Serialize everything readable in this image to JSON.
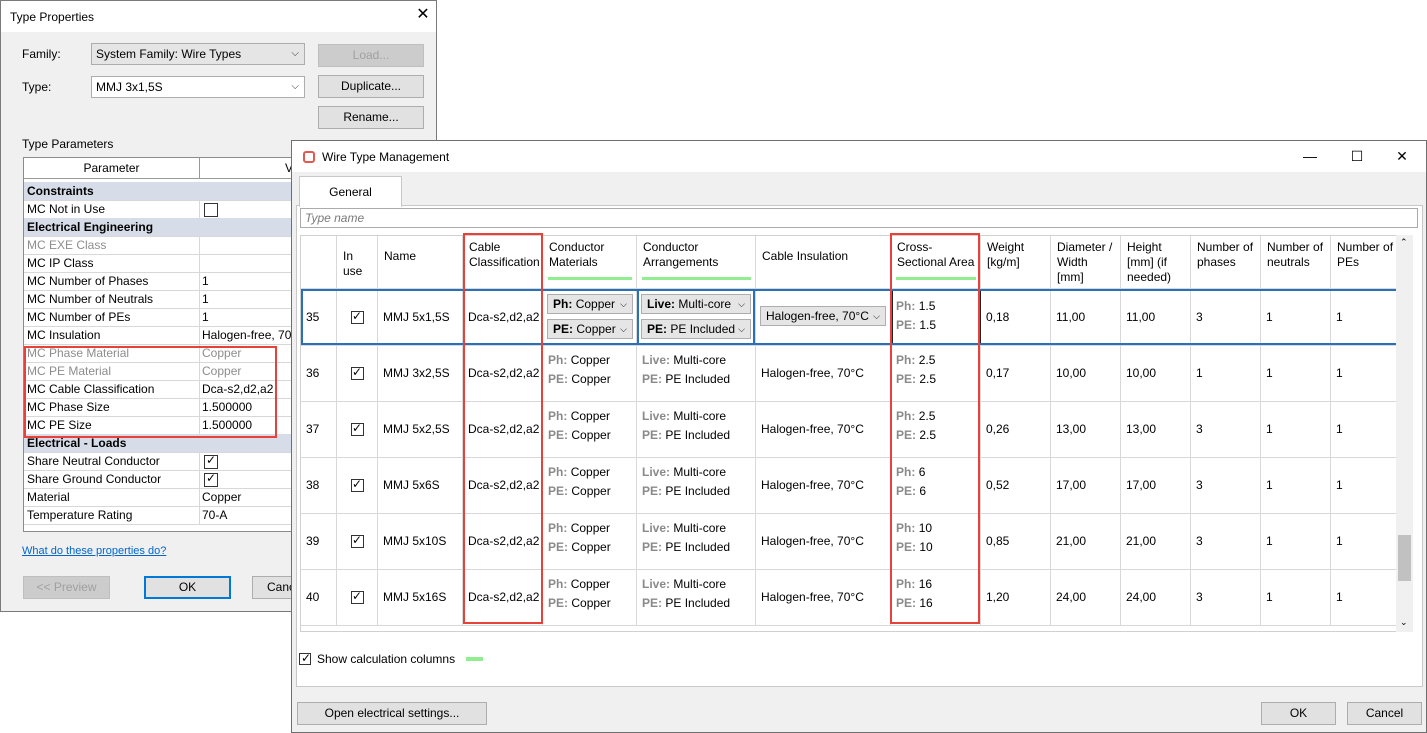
{
  "type_properties": {
    "title": "Type Properties",
    "family_label": "Family:",
    "family_value": "System Family: Wire Types",
    "type_label": "Type:",
    "type_value": "MMJ 3x1,5S",
    "load_button": "Load...",
    "duplicate_button": "Duplicate...",
    "rename_button": "Rename...",
    "type_parameters_label": "Type Parameters",
    "col_parameter": "Parameter",
    "col_value": "Va",
    "rows": [
      {
        "name": "Constraints",
        "group": true
      },
      {
        "name": "MC Not in Use",
        "check": false
      },
      {
        "name": "Electrical Engineering",
        "group": true
      },
      {
        "name": "MC EXE Class",
        "value": "",
        "gray": true
      },
      {
        "name": "MC IP Class",
        "value": ""
      },
      {
        "name": "MC Number of Phases",
        "value": "1"
      },
      {
        "name": "MC Number of Neutrals",
        "value": "1"
      },
      {
        "name": "MC Number of PEs",
        "value": "1"
      },
      {
        "name": "MC Insulation",
        "value": "Halogen-free, 70"
      },
      {
        "name": "MC Phase Material",
        "value": "Copper",
        "gray": true
      },
      {
        "name": "MC PE Material",
        "value": "Copper",
        "gray": true
      },
      {
        "name": "MC Cable Classification",
        "value": "Dca-s2,d2,a2"
      },
      {
        "name": "MC Phase Size",
        "value": "1.500000"
      },
      {
        "name": "MC PE Size",
        "value": "1.500000"
      },
      {
        "name": "Electrical - Loads",
        "group": true
      },
      {
        "name": "Share Neutral Conductor",
        "check": true
      },
      {
        "name": "Share Ground Conductor",
        "check": true
      },
      {
        "name": "Material",
        "value": "Copper"
      },
      {
        "name": "Temperature Rating",
        "value": "70-A"
      }
    ],
    "help_link": "What do these properties do?",
    "preview_button": "<< Preview",
    "ok_button": "OK",
    "cancel_button": "Canc"
  },
  "wire_type_management": {
    "title": "Wire Type Management",
    "tab_general": "General",
    "search_placeholder": "Type name",
    "columns": [
      "",
      "In use",
      "Name",
      "Cable\nClassification",
      "Conductor\nMaterials",
      "Conductor\nArrangements",
      "Cable Insulation",
      "Cross-\nSectional Area",
      "Weight\n[kg/m]",
      "Diameter /\nWidth\n[mm]",
      "Height\n[mm] (if\nneeded)",
      "Number of\nphases",
      "Number of\nneutrals",
      "Number of\nPEs"
    ],
    "rows": [
      {
        "id": "35",
        "name": "MMJ 5x1,5S",
        "classification": "Dca-s2,d2,a2",
        "ph_material": "Copper",
        "pe_material": "Copper",
        "live": "Multi-core",
        "pe_arr": "PE Included",
        "insulation": "Halogen-free, 70°C",
        "ph_area": "1.5",
        "pe_area": "1.5",
        "weight": "0,18",
        "diameter": "11,00",
        "height": "11,00",
        "phases": "3",
        "neutrals": "1",
        "pes": "1"
      },
      {
        "id": "36",
        "name": "MMJ 3x2,5S",
        "classification": "Dca-s2,d2,a2",
        "ph_material": "Copper",
        "pe_material": "Copper",
        "live": "Multi-core",
        "pe_arr": "PE Included",
        "insulation": "Halogen-free, 70°C",
        "ph_area": "2.5",
        "pe_area": "2.5",
        "weight": "0,17",
        "diameter": "10,00",
        "height": "10,00",
        "phases": "1",
        "neutrals": "1",
        "pes": "1"
      },
      {
        "id": "37",
        "name": "MMJ 5x2,5S",
        "classification": "Dca-s2,d2,a2",
        "ph_material": "Copper",
        "pe_material": "Copper",
        "live": "Multi-core",
        "pe_arr": "PE Included",
        "insulation": "Halogen-free, 70°C",
        "ph_area": "2.5",
        "pe_area": "2.5",
        "weight": "0,26",
        "diameter": "13,00",
        "height": "13,00",
        "phases": "3",
        "neutrals": "1",
        "pes": "1"
      },
      {
        "id": "38",
        "name": "MMJ 5x6S",
        "classification": "Dca-s2,d2,a2",
        "ph_material": "Copper",
        "pe_material": "Copper",
        "live": "Multi-core",
        "pe_arr": "PE Included",
        "insulation": "Halogen-free, 70°C",
        "ph_area": "6",
        "pe_area": "6",
        "weight": "0,52",
        "diameter": "17,00",
        "height": "17,00",
        "phases": "3",
        "neutrals": "1",
        "pes": "1"
      },
      {
        "id": "39",
        "name": "MMJ 5x10S",
        "classification": "Dca-s2,d2,a2",
        "ph_material": "Copper",
        "pe_material": "Copper",
        "live": "Multi-core",
        "pe_arr": "PE Included",
        "insulation": "Halogen-free, 70°C",
        "ph_area": "10",
        "pe_area": "10",
        "weight": "0,85",
        "diameter": "21,00",
        "height": "21,00",
        "phases": "3",
        "neutrals": "1",
        "pes": "1"
      },
      {
        "id": "40",
        "name": "MMJ 5x16S",
        "classification": "Dca-s2,d2,a2",
        "ph_material": "Copper",
        "pe_material": "Copper",
        "live": "Multi-core",
        "pe_arr": "PE Included",
        "insulation": "Halogen-free, 70°C",
        "ph_area": "16",
        "pe_area": "16",
        "weight": "1,20",
        "diameter": "24,00",
        "height": "24,00",
        "phases": "3",
        "neutrals": "1",
        "pes": "1"
      }
    ],
    "prefix_ph": "Ph:",
    "prefix_pe": "PE:",
    "prefix_live": "Live:",
    "show_calc_label": "Show calculation columns",
    "open_settings_button": "Open electrical settings...",
    "ok_button": "OK",
    "cancel_button": "Cancel"
  },
  "colors": {
    "highlight": "#e8413a",
    "calc_marker": "#90ee90",
    "selection": "#2a70b8"
  }
}
